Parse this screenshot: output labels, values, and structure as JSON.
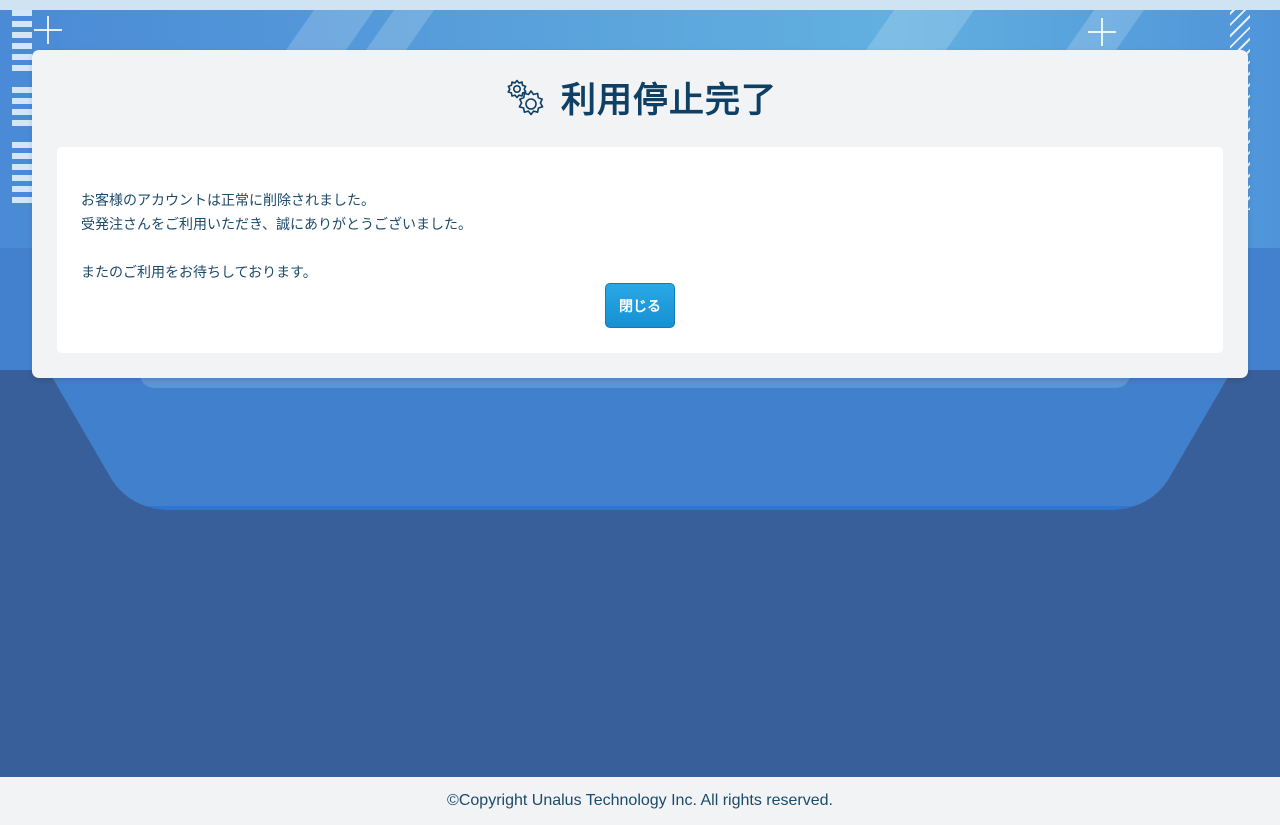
{
  "page": {
    "title": "利用停止完了",
    "title_icon": "gears-icon"
  },
  "message": {
    "line1": "お客様のアカウントは正常に削除されました。",
    "line2": "受発注さんをご利用いただき、誠にありがとうございました。",
    "line3": "またのご利用をお待ちしております。"
  },
  "actions": {
    "close_label": "閉じる"
  },
  "footer": {
    "copyright": "©Copyright Unalus Technology Inc. All rights reserved."
  },
  "colors": {
    "page_background": "#385f99",
    "banner_blue": "#4a8ad6",
    "card_background": "#f2f3f5",
    "title_color": "#0e3f64",
    "button_blue": "#1690d4"
  }
}
